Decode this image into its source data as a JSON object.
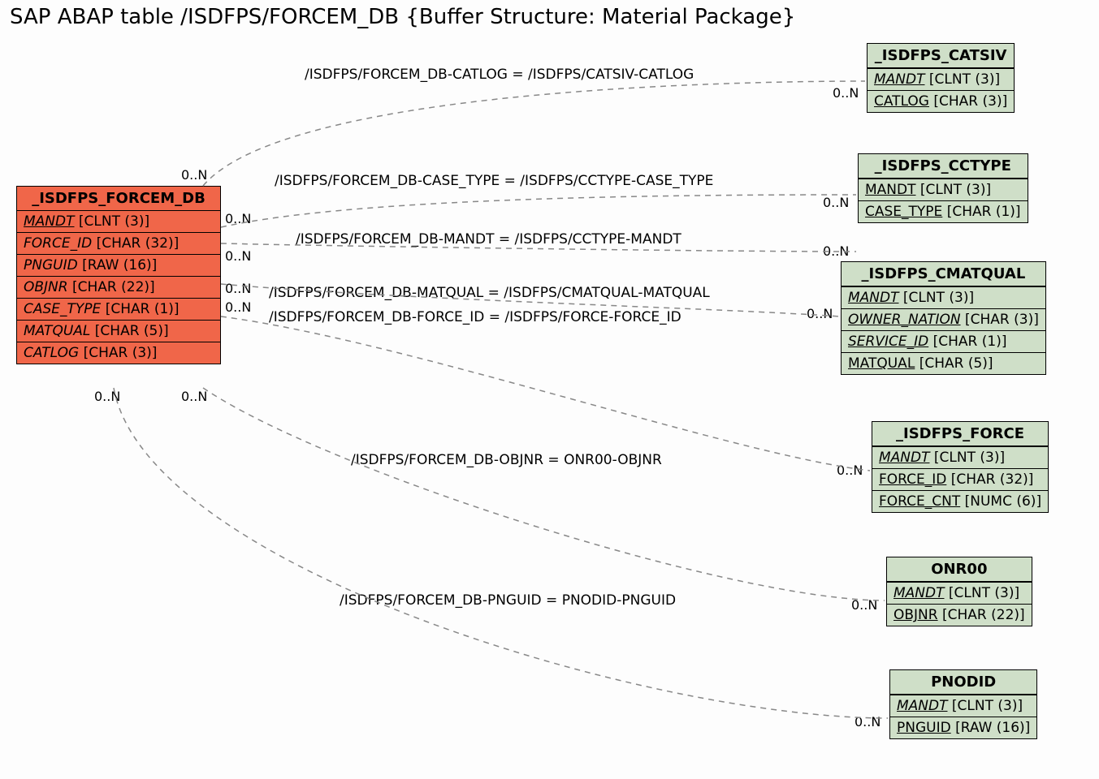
{
  "title": "SAP ABAP table /ISDFPS/FORCEM_DB {Buffer Structure: Material Package}",
  "main": {
    "name": "_ISDFPS_FORCEM_DB",
    "fields": [
      {
        "label": "MANDT",
        "type": "[CLNT (3)]",
        "underline": true
      },
      {
        "label": "FORCE_ID",
        "type": "[CHAR (32)]",
        "underline": false
      },
      {
        "label": "PNGUID",
        "type": "[RAW (16)]",
        "underline": false
      },
      {
        "label": "OBJNR",
        "type": "[CHAR (22)]",
        "underline": false
      },
      {
        "label": "CASE_TYPE",
        "type": "[CHAR (1)]",
        "underline": false
      },
      {
        "label": "MATQUAL",
        "type": "[CHAR (5)]",
        "underline": false
      },
      {
        "label": "CATLOG",
        "type": "[CHAR (3)]",
        "underline": false
      }
    ]
  },
  "refs": {
    "catsiv": {
      "name": "_ISDFPS_CATSIV",
      "fields": [
        {
          "label": "MANDT",
          "type": "[CLNT (3)]",
          "underline": true
        },
        {
          "label": "CATLOG",
          "type": "[CHAR (3)]",
          "underline": true
        }
      ]
    },
    "cctype": {
      "name": "_ISDFPS_CCTYPE",
      "fields": [
        {
          "label": "MANDT",
          "type": "[CLNT (3)]",
          "underline": true
        },
        {
          "label": "CASE_TYPE",
          "type": "[CHAR (1)]",
          "underline": true
        }
      ]
    },
    "cmatqual": {
      "name": "_ISDFPS_CMATQUAL",
      "fields": [
        {
          "label": "MANDT",
          "type": "[CLNT (3)]",
          "underline": true
        },
        {
          "label": "OWNER_NATION",
          "type": "[CHAR (3)]",
          "underline": true
        },
        {
          "label": "SERVICE_ID",
          "type": "[CHAR (1)]",
          "underline": true
        },
        {
          "label": "MATQUAL",
          "type": "[CHAR (5)]",
          "underline": true
        }
      ]
    },
    "force": {
      "name": "_ISDFPS_FORCE",
      "fields": [
        {
          "label": "MANDT",
          "type": "[CLNT (3)]",
          "underline": true
        },
        {
          "label": "FORCE_ID",
          "type": "[CHAR (32)]",
          "underline": true
        },
        {
          "label": "FORCE_CNT",
          "type": "[NUMC (6)]",
          "underline": true
        }
      ]
    },
    "onr00": {
      "name": "ONR00",
      "fields": [
        {
          "label": "MANDT",
          "type": "[CLNT (3)]",
          "underline": true
        },
        {
          "label": "OBJNR",
          "type": "[CHAR (22)]",
          "underline": true
        }
      ]
    },
    "pnodid": {
      "name": "PNODID",
      "fields": [
        {
          "label": "MANDT",
          "type": "[CLNT (3)]",
          "underline": true
        },
        {
          "label": "PNGUID",
          "type": "[RAW (16)]",
          "underline": true
        }
      ]
    }
  },
  "edges": {
    "catlog": "/ISDFPS/FORCEM_DB-CATLOG = /ISDFPS/CATSIV-CATLOG",
    "casetype": "/ISDFPS/FORCEM_DB-CASE_TYPE = /ISDFPS/CCTYPE-CASE_TYPE",
    "mandt": "/ISDFPS/FORCEM_DB-MANDT = /ISDFPS/CCTYPE-MANDT",
    "matqual": "/ISDFPS/FORCEM_DB-MATQUAL = /ISDFPS/CMATQUAL-MATQUAL",
    "forceid": "/ISDFPS/FORCEM_DB-FORCE_ID = /ISDFPS/FORCE-FORCE_ID",
    "objnr": "/ISDFPS/FORCEM_DB-OBJNR = ONR00-OBJNR",
    "pnguid": "/ISDFPS/FORCEM_DB-PNGUID = PNODID-PNGUID"
  },
  "cards": {
    "main_top": "0..N",
    "main_r1": "0..N",
    "main_r2": "0..N",
    "main_r3": "0..N",
    "main_r4": "0..N",
    "main_b1": "0..N",
    "main_b2": "0..N",
    "catsiv": "0..N",
    "cctype": "0..N",
    "cctype2": "0..N",
    "cmatqual": "0..N",
    "force": "0..N",
    "onr00": "0..N",
    "pnodid": "0..N"
  }
}
